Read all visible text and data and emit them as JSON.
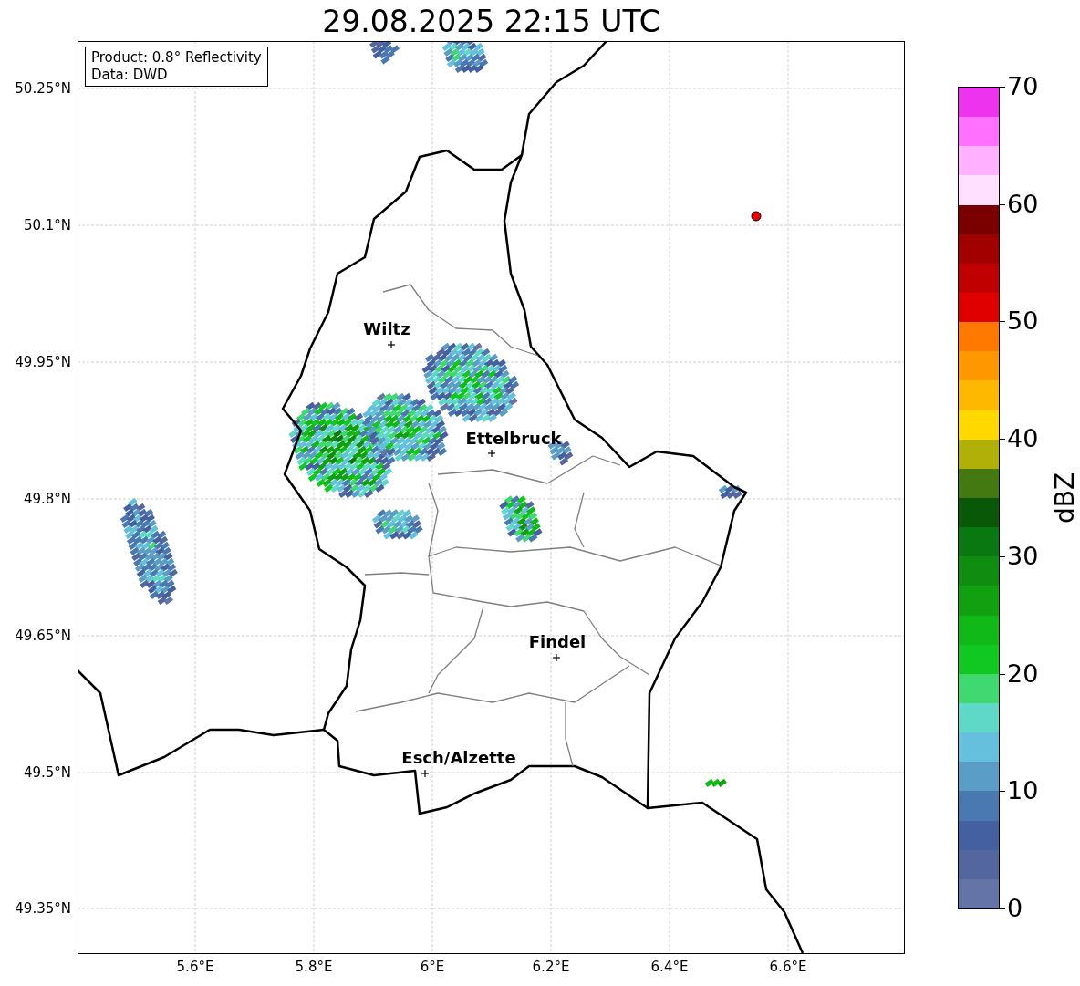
{
  "title": "29.08.2025 22:15 UTC",
  "info_box": [
    "Product: 0.8° Reflectivity",
    "Data: DWD"
  ],
  "map": {
    "y_ticks": [
      "50.25°N",
      "50.1°N",
      "49.95°N",
      "49.8°N",
      "49.65°N",
      "49.5°N",
      "49.35°N"
    ],
    "x_ticks": [
      "5.6°E",
      "5.8°E",
      "6°E",
      "6.2°E",
      "6.4°E",
      "6.6°E"
    ],
    "cities": [
      {
        "name": "Wiltz"
      },
      {
        "name": "Ettelbruck"
      },
      {
        "name": "Findel"
      },
      {
        "name": "Esch/Alzette"
      }
    ]
  },
  "colorbar": {
    "label": "dBZ",
    "ticks": [
      "70",
      "60",
      "50",
      "40",
      "30",
      "20",
      "10",
      "0"
    ],
    "bands": [
      {
        "color": "#ee33ee"
      },
      {
        "color": "#ff70ff"
      },
      {
        "color": "#ffb0ff"
      },
      {
        "color": "#ffe0ff"
      },
      {
        "color": "#7a0000"
      },
      {
        "color": "#a00000"
      },
      {
        "color": "#c00000"
      },
      {
        "color": "#e00000"
      },
      {
        "color": "#ff7800"
      },
      {
        "color": "#ff9800"
      },
      {
        "color": "#ffb800"
      },
      {
        "color": "#ffd800"
      },
      {
        "color": "#b0b008"
      },
      {
        "color": "#447810"
      },
      {
        "color": "#085808"
      },
      {
        "color": "#0a7810"
      },
      {
        "color": "#108c10"
      },
      {
        "color": "#10a010"
      },
      {
        "color": "#10b818"
      },
      {
        "color": "#10c820"
      },
      {
        "color": "#40d870"
      },
      {
        "color": "#60d8c8"
      },
      {
        "color": "#64c0dc"
      },
      {
        "color": "#5a9ec8"
      },
      {
        "color": "#4a78b0"
      },
      {
        "color": "#4460a0"
      },
      {
        "color": "#53669e"
      },
      {
        "color": "#6474a6"
      }
    ]
  }
}
